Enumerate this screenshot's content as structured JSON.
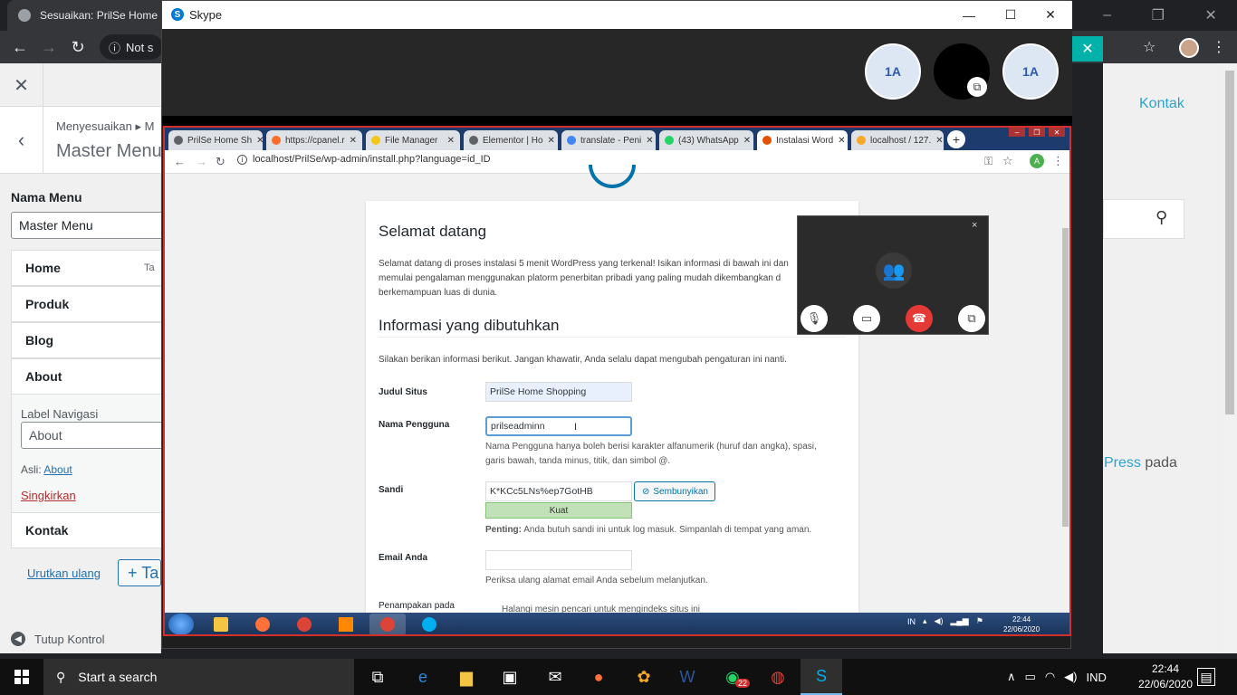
{
  "outer_browser": {
    "tab_title": "Sesuaikan: PrilSe Home S",
    "omnibox_text": "Not s",
    "window_controls": [
      "–",
      "❐",
      "✕"
    ]
  },
  "wp_customizer": {
    "close_icon": "✕",
    "back_icon": "‹",
    "breadcrumb": "Menyesuaikan ▸ M",
    "title": "Master Menu",
    "nama_menu_label": "Nama Menu",
    "nama_menu_value": "Master Menu",
    "items": [
      {
        "label": "Home",
        "tail": "Ta"
      },
      {
        "label": "Produk",
        "tail": ""
      },
      {
        "label": "Blog",
        "tail": ""
      },
      {
        "label": "About",
        "tail": ""
      }
    ],
    "label_navigasi": "Label Navigasi",
    "label_navigasi_value": "About",
    "asli_prefix": "Asli:",
    "asli_link": "About",
    "singkirkan": "Singkirkan",
    "kontak_item": "Kontak",
    "urutkan": "Urutkan ulang",
    "tambah_prefix": "+ Ta",
    "tutup": "Tutup Kontrol"
  },
  "outer_right": {
    "kontak": "Kontak",
    "press_link": "Press",
    "press_rest": " pada"
  },
  "skype": {
    "title": "Skype",
    "participants": [
      "1A",
      "",
      "1A"
    ],
    "mini_call": {
      "close": "×"
    }
  },
  "inner_browser": {
    "tabs": [
      {
        "title": "PrilSe Home Sh",
        "color": "#5f6368",
        "active": false
      },
      {
        "title": "https://cpanel.r",
        "color": "#ff6c2c",
        "active": false
      },
      {
        "title": "File Manager",
        "color": "#f5c518",
        "active": false
      },
      {
        "title": "Elementor | Ho",
        "color": "#5f6368",
        "active": false
      },
      {
        "title": "translate - Peni",
        "color": "#4285f4",
        "active": false
      },
      {
        "title": "(43) WhatsApp",
        "color": "#25d366",
        "active": false
      },
      {
        "title": "Instalasi Word",
        "color": "#e65100",
        "active": true
      },
      {
        "title": "localhost / 127.",
        "color": "#f9a825",
        "active": false
      }
    ],
    "url": "localhost/PrilSe/wp-admin/install.php?language=id_ID",
    "profile_initial": "A"
  },
  "install_page": {
    "heading_welcome": "Selamat datang",
    "welcome_text": "Selamat datang di proses instalasi 5 menit WordPress yang terkenal! Isikan informasi di bawah ini dan memulai pengalaman menggunakan platorm penerbitan pribadi yang paling mudah dikembangkan d berkemampuan luas di dunia.",
    "heading_info": "Informasi yang dibutuhkan",
    "silakan_text": "Silakan berikan informasi berikut. Jangan khawatir, Anda selalu dapat mengubah pengaturan ini nanti.",
    "judul_label": "Judul Situs",
    "judul_value": "PrilSe Home Shopping",
    "nama_label": "Nama Pengguna",
    "nama_value": "prilseadminn",
    "nama_hint": "Nama Pengguna hanya boleh berisi karakter alfanumerik (huruf dan angka), spasi, garis bawah, tanda minus, titik, dan simbol @.",
    "sandi_label": "Sandi",
    "sandi_value": "K*KCc5LNs%ep7GotHB",
    "hide_button": "Sembunyikan",
    "strength": "Kuat",
    "penting_bold": "Penting:",
    "penting_text": " Anda butuh sandi ini untuk log masuk. Simpanlah di tempat yang aman.",
    "email_label": "Email Anda",
    "email_value": "",
    "email_hint": "Periksa ulang alamat email Anda sebelum melanjutkan.",
    "penampakan_label": "Penampakan pada",
    "penampakan_hint": "Halangi mesin pencari untuk mengindeks situs ini"
  },
  "inner_taskbar": {
    "lang": "IN",
    "time": "22:44",
    "date": "22/06/2020"
  },
  "taskbar": {
    "search_placeholder": "Start a search",
    "whatsapp_badge": "22",
    "lang": "IND",
    "time": "22:44",
    "date": "22/06/2020"
  }
}
